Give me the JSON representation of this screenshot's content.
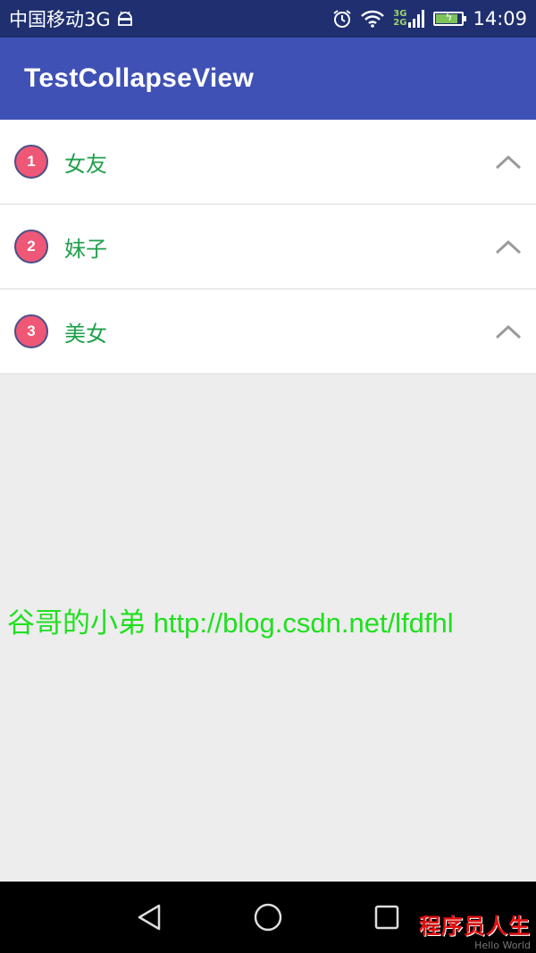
{
  "status_bar": {
    "carrier": "中国移动3G",
    "time": "14:09",
    "net_top": "3G",
    "net_bottom": "2G",
    "battery_level": 0.85,
    "icons": [
      "android-icon",
      "alarm-icon",
      "wifi-icon",
      "signal-icon",
      "battery-icon"
    ]
  },
  "app_bar": {
    "title": "TestCollapseView",
    "color": "#3f51b5"
  },
  "list": {
    "items": [
      {
        "number": "1",
        "label": "女友"
      },
      {
        "number": "2",
        "label": "妹子"
      },
      {
        "number": "3",
        "label": "美女"
      }
    ],
    "badge_color": "#ef5776",
    "label_color": "#1fa04a"
  },
  "watermark": {
    "text": "谷哥的小弟 http://blog.csdn.net/lfdfhl"
  },
  "nav_bar": {
    "buttons": [
      "back-icon",
      "home-icon",
      "recents-icon"
    ],
    "logo_text": "程序员人生",
    "logo_sub": "Hello World"
  }
}
